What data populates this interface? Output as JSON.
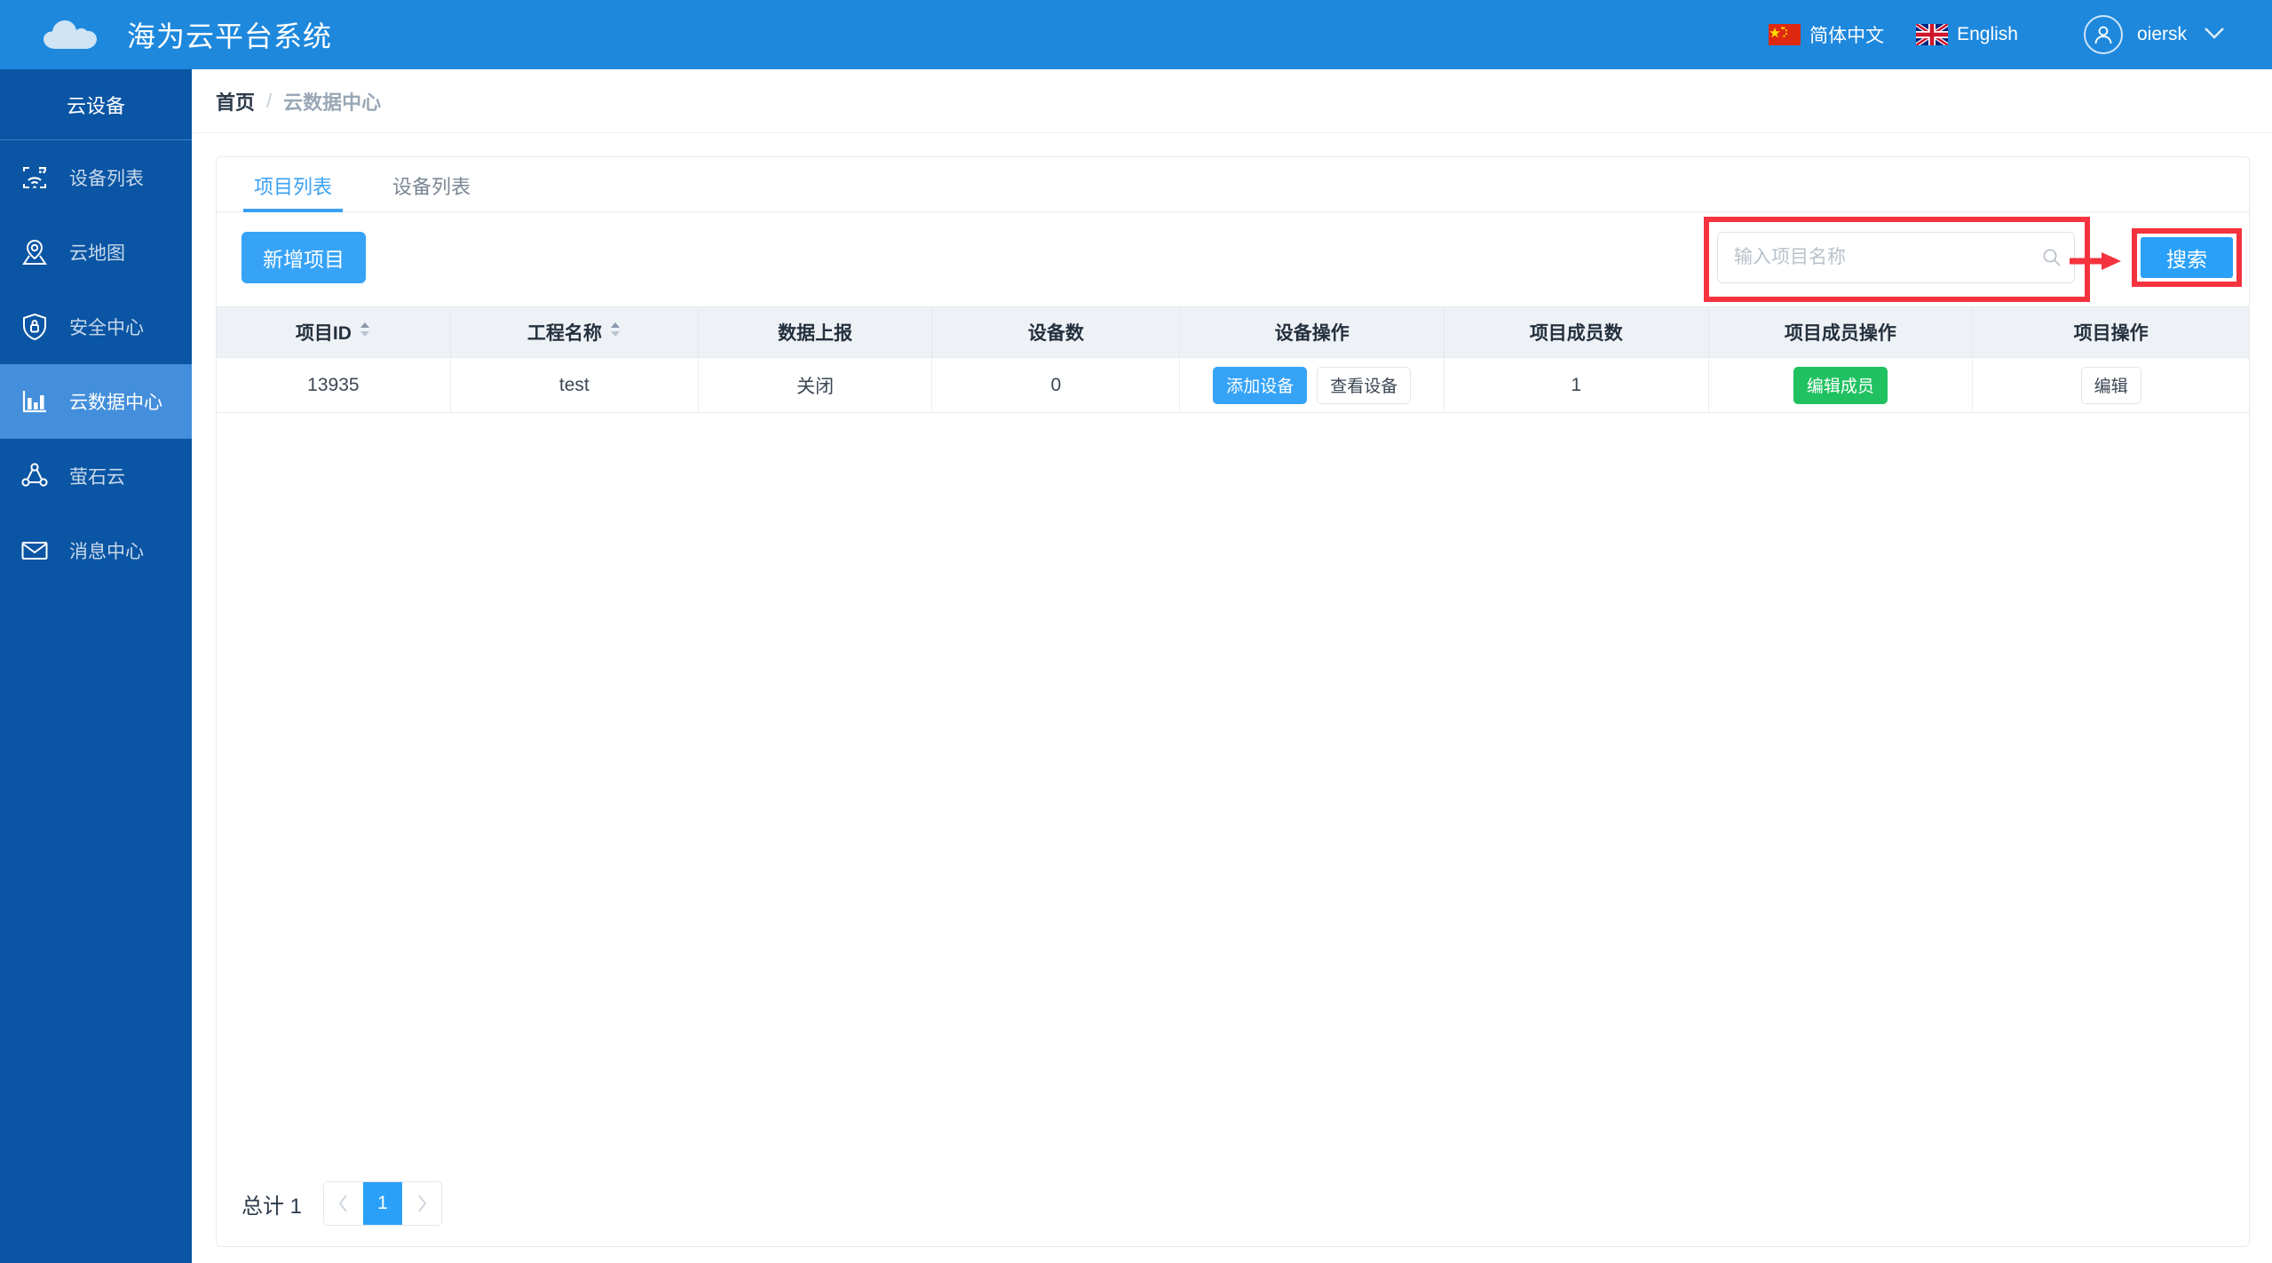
{
  "header": {
    "logo_icon": "cloud-icon",
    "title": "海为云平台系统",
    "languages": [
      {
        "label": "简体中文",
        "flag": "china-flag-icon"
      },
      {
        "label": "English",
        "flag": "uk-flag-icon"
      }
    ],
    "user": {
      "name": "oiersk",
      "avatar_icon": "user-avatar-icon",
      "caret_icon": "chevron-down-icon"
    }
  },
  "sidebar": {
    "title": "云设备",
    "items": [
      {
        "label": "设备列表",
        "icon": "device-list-icon",
        "active": false
      },
      {
        "label": "云地图",
        "icon": "map-pin-icon",
        "active": false
      },
      {
        "label": "安全中心",
        "icon": "shield-lock-icon",
        "active": false
      },
      {
        "label": "云数据中心",
        "icon": "bar-chart-icon",
        "active": true
      },
      {
        "label": "萤石云",
        "icon": "share-nodes-icon",
        "active": false
      },
      {
        "label": "消息中心",
        "icon": "envelope-icon",
        "active": false
      }
    ]
  },
  "breadcrumb": {
    "home": "首页",
    "separator": "/",
    "current": "云数据中心"
  },
  "tabs": [
    {
      "label": "项目列表",
      "active": true
    },
    {
      "label": "设备列表",
      "active": false
    }
  ],
  "toolbar": {
    "new_project_label": "新增项目",
    "search_placeholder": "输入项目名称",
    "search_value": "",
    "search_button_label": "搜索",
    "search_icon": "magnifier-icon"
  },
  "annotations": {
    "box_color": "#f5333f",
    "arrow_icon": "arrow-right-icon",
    "highlighted": [
      "search-input",
      "search-button"
    ]
  },
  "table": {
    "columns": [
      {
        "label": "项目ID",
        "sortable": true
      },
      {
        "label": "工程名称",
        "sortable": true
      },
      {
        "label": "数据上报",
        "sortable": false
      },
      {
        "label": "设备数",
        "sortable": false
      },
      {
        "label": "设备操作",
        "sortable": false
      },
      {
        "label": "项目成员数",
        "sortable": false
      },
      {
        "label": "项目成员操作",
        "sortable": false
      },
      {
        "label": "项目操作",
        "sortable": false
      }
    ],
    "rows": [
      {
        "project_id": "13935",
        "project_name": "test",
        "data_report": "关闭",
        "device_count": "0",
        "device_actions": [
          {
            "label": "添加设备",
            "style": "primary"
          },
          {
            "label": "查看设备",
            "style": "default"
          }
        ],
        "member_count": "1",
        "member_actions": [
          {
            "label": "编辑成员",
            "style": "success"
          }
        ],
        "project_actions": [
          {
            "label": "编辑",
            "style": "default"
          }
        ]
      }
    ]
  },
  "pagination": {
    "total_label": "总计 1",
    "prev_icon": "chevron-left-icon",
    "next_icon": "chevron-right-icon",
    "pages": [
      "1"
    ],
    "current_page": "1"
  },
  "colors": {
    "header_blue": "#1e88dd",
    "sidebar_blue": "#0a55a4",
    "sidebar_active": "#438fdb",
    "accent_blue": "#36a3f7",
    "success_green": "#20c161",
    "annotation_red": "#f5333f"
  }
}
